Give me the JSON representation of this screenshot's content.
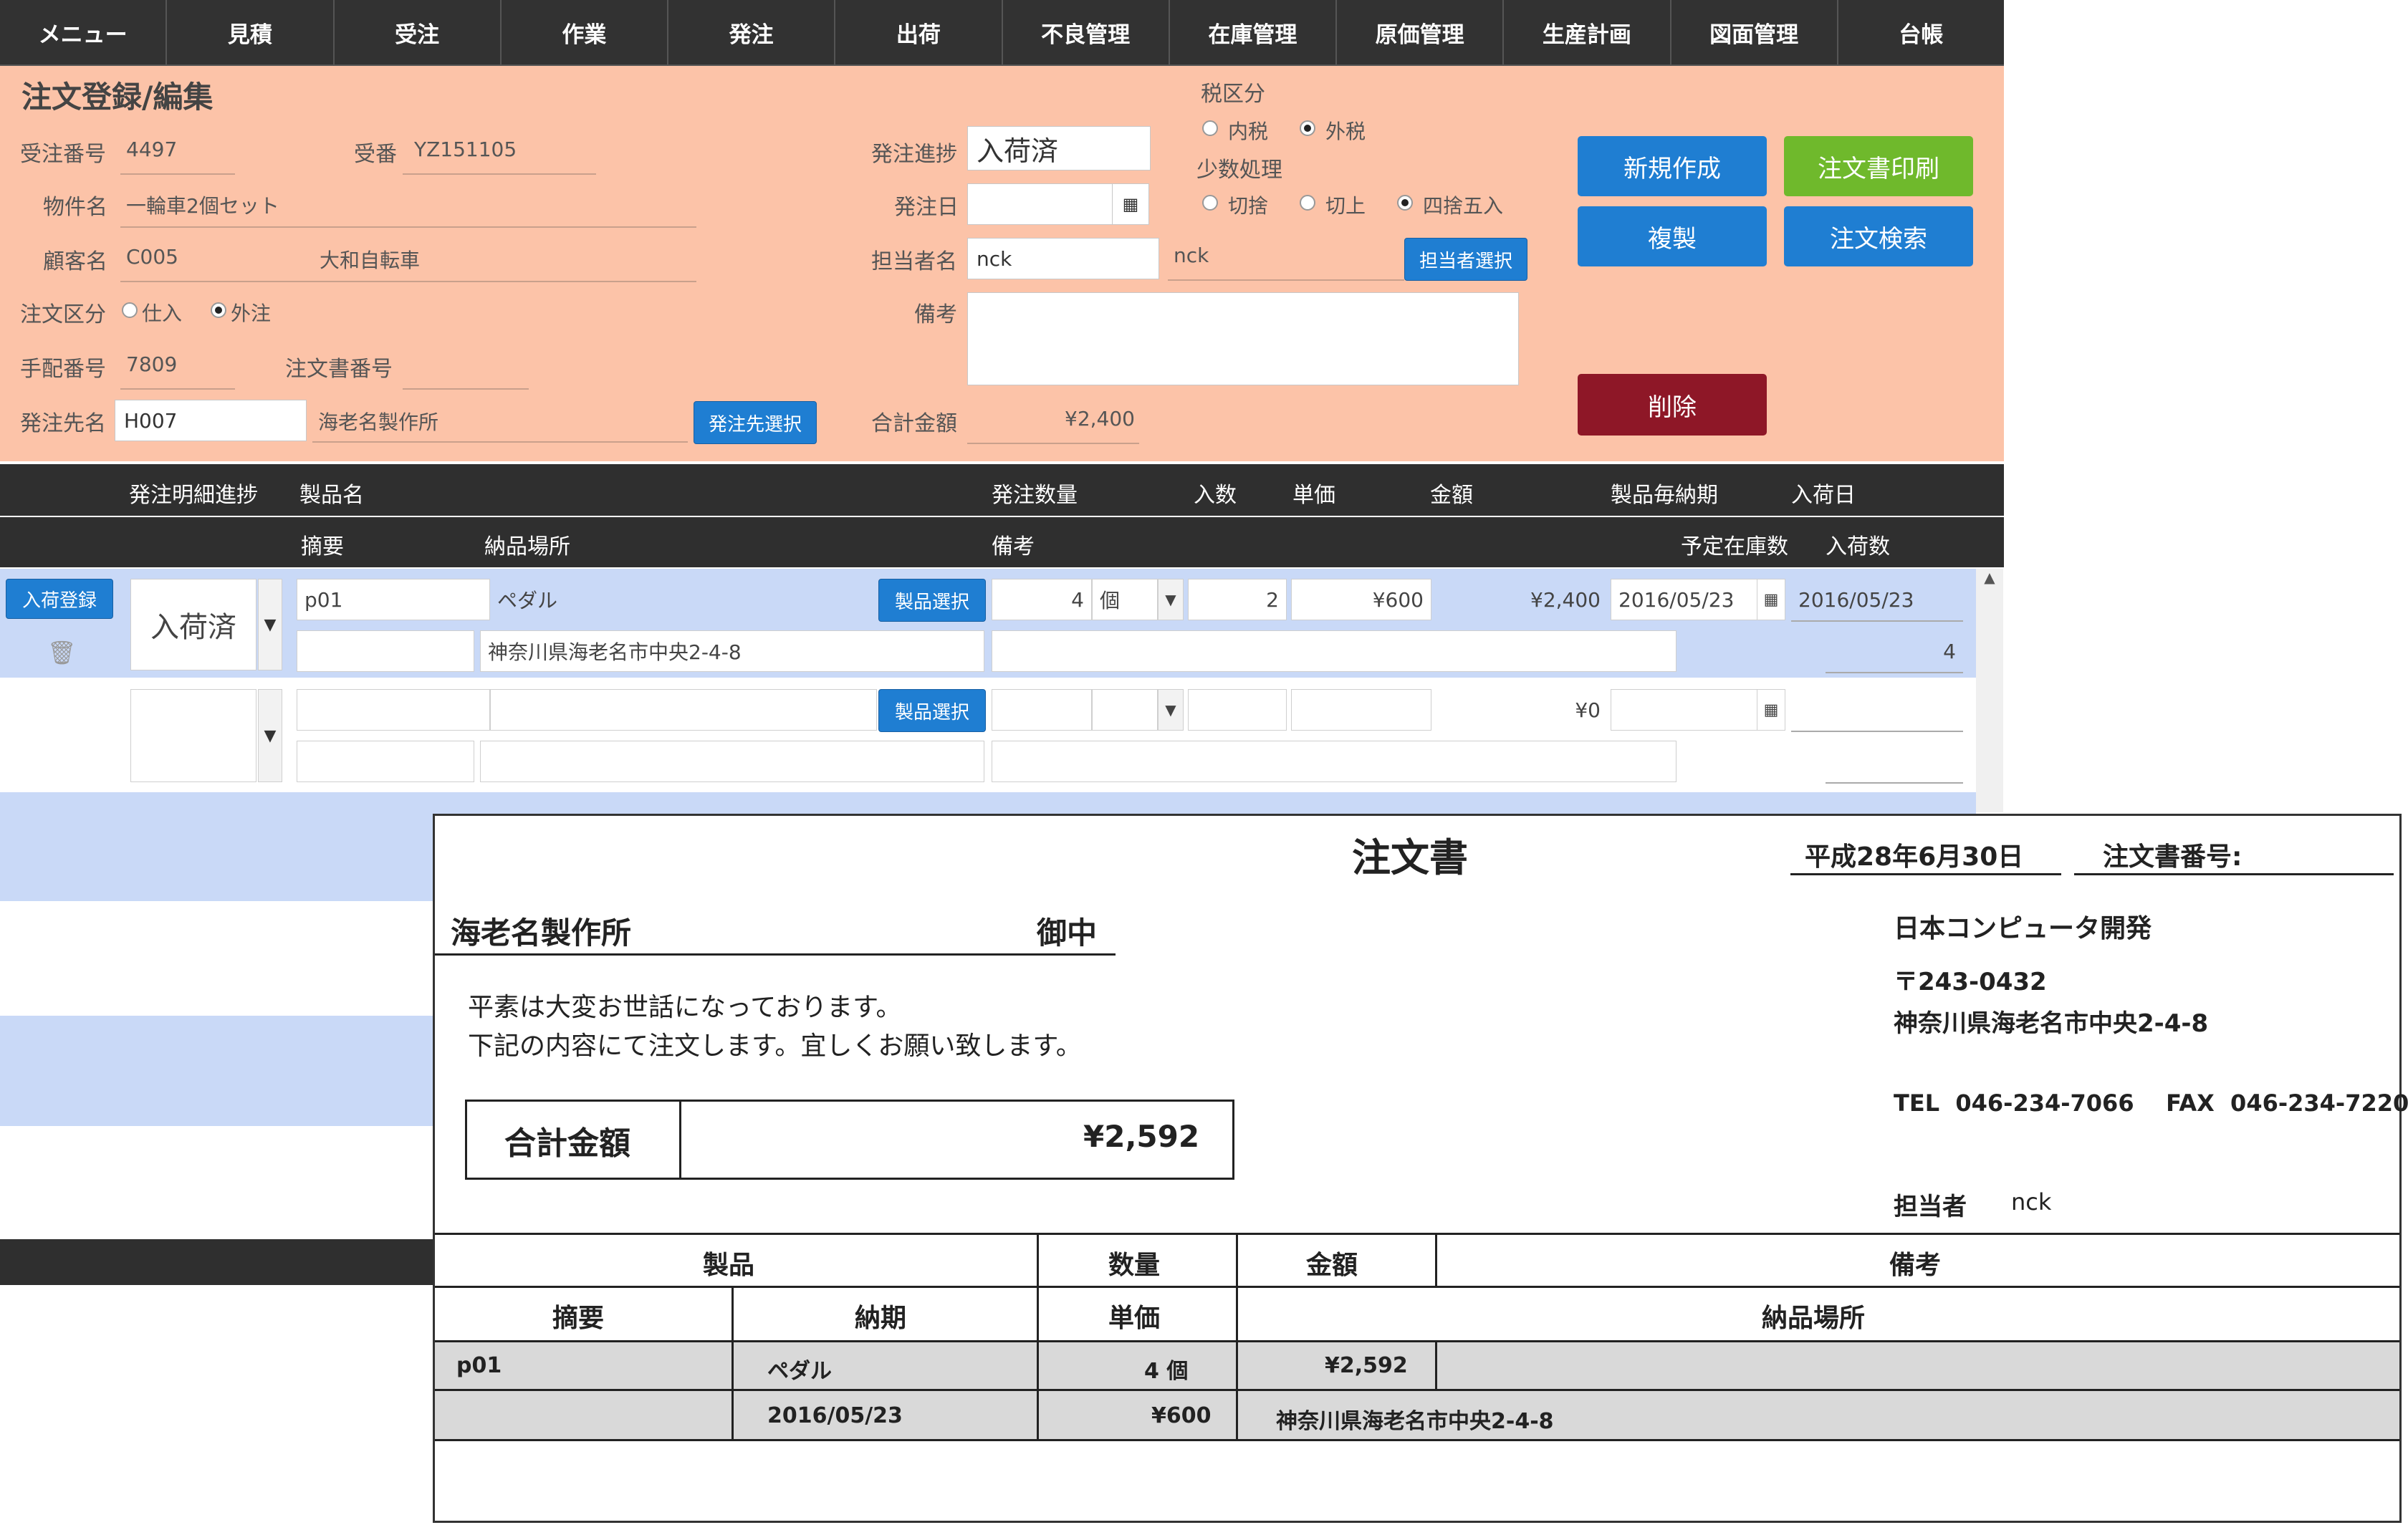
{
  "nav": [
    "メニュー",
    "見積",
    "受注",
    "作業",
    "発注",
    "出荷",
    "不良管理",
    "在庫管理",
    "原価管理",
    "生産計画",
    "図面管理",
    "台帳"
  ],
  "form": {
    "title": "注文登録/編集",
    "order_no_label": "受注番号",
    "order_no": "4497",
    "ukeban_label": "受番",
    "ukeban": "YZ151105",
    "project_label": "物件名",
    "project": "一輪車2個セット",
    "customer_label": "顧客名",
    "customer_code": "C005",
    "customer_name": "大和自転車",
    "order_type_label": "注文区分",
    "order_type_options": [
      "仕入",
      "外注"
    ],
    "order_type_selected": "外注",
    "arrange_no_label": "手配番号",
    "arrange_no": "7809",
    "po_no_label": "注文書番号",
    "po_no": "",
    "supplier_label": "発注先名",
    "supplier_code": "H007",
    "supplier_name": "海老名製作所",
    "supplier_select_btn": "発注先選択",
    "progress_label": "発注進捗",
    "progress": "入荷済",
    "order_date_label": "発注日",
    "order_date": "",
    "staff_label": "担当者名",
    "staff": "nck",
    "staff_name": "nck",
    "staff_select_btn": "担当者選択",
    "remarks_label": "備考",
    "remarks": "",
    "total_label": "合計金額",
    "total": "¥2,400",
    "tax_label": "税区分",
    "tax_options": [
      "内税",
      "外税"
    ],
    "tax_selected": "外税",
    "rounding_label": "少数処理",
    "rounding_options": [
      "切捨",
      "切上",
      "四捨五入"
    ],
    "rounding_selected": "四捨五入",
    "buttons": {
      "new": "新規作成",
      "print": "注文書印刷",
      "copy": "複製",
      "search": "注文検索",
      "delete": "削除"
    },
    "colors": {
      "panel": "#fcc3a8",
      "blue": "#1f7ed2",
      "green": "#6fb92c",
      "red": "#8e1727"
    }
  },
  "detail": {
    "header1": [
      "発注明細進捗",
      "製品名",
      "発注数量",
      "入数",
      "単価",
      "金額",
      "製品毎納期",
      "入荷日"
    ],
    "header2": [
      "摘要",
      "納品場所",
      "備考",
      "予定在庫数",
      "入荷数"
    ],
    "row1": {
      "arrival_btn": "入荷登録",
      "status": "入荷済",
      "code": "p01",
      "product": "ペダル",
      "product_btn": "製品選択",
      "qty": "4",
      "unit": "個",
      "irisu": "2",
      "price": "¥600",
      "amount": "¥2,400",
      "due": "2016/05/23",
      "arrival": "2016/05/23",
      "place": "神奈川県海老名市中央2-4-8",
      "arrived_qty": "4"
    },
    "row2": {
      "product_btn": "製品選択",
      "amount": "¥0"
    }
  },
  "sheet": {
    "title": "注文書",
    "date": "平成28年6月30日",
    "po_no_label": "注文書番号:",
    "to": "海老名製作所",
    "honorific": "御中",
    "greeting1": "平素は大変お世話になっております。",
    "greeting2": "下記の内容にて注文します。宜しくお願い致します。",
    "total_label": "合計金額",
    "total": "¥2,592",
    "company": "日本コンピュータ開発",
    "postal": "〒243-0432",
    "address": "神奈川県海老名市中央2-4-8",
    "tel": "TEL  046-234-7066    FAX  046-234-7220",
    "staff_label": "担当者",
    "staff": "nck",
    "table_h1": [
      "製品",
      "数量",
      "金額",
      "備考"
    ],
    "table_h2": [
      "摘要",
      "納期",
      "単価",
      "納品場所"
    ],
    "row": {
      "code": "p01",
      "product": "ペダル",
      "qty": "4 個",
      "amount": "¥2,592",
      "due": "2016/05/23",
      "price": "¥600",
      "place": "神奈川県海老名市中央2-4-8"
    }
  }
}
